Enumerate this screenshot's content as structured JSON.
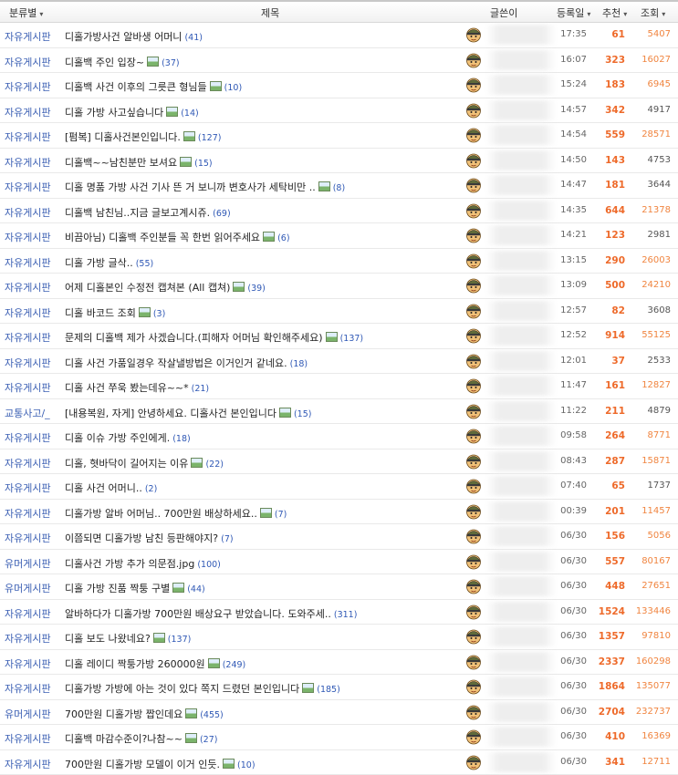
{
  "header": {
    "category": "분류별",
    "title": "제목",
    "author": "글쓴이",
    "date": "등록일",
    "recommend": "추천",
    "views": "조회",
    "sort_arrow": "▾"
  },
  "colors": {
    "category": "#3b5fb3",
    "count": "#2f58b5",
    "recommend": "#ee6a2a",
    "views_hot": "#f08540",
    "views_normal": "#555555"
  },
  "rows": [
    {
      "category": "자유게시판",
      "title": "디홀가방사건 알바생 어머니",
      "attach": false,
      "count": "(41)",
      "time": "17:35",
      "recommend": "61",
      "views": "5407",
      "hot": true
    },
    {
      "category": "자유게시판",
      "title": "디홀백 주인 입장~",
      "attach": true,
      "count": "(37)",
      "time": "16:07",
      "recommend": "323",
      "views": "16027",
      "hot": true
    },
    {
      "category": "자유게시판",
      "title": "디홀백 사건 이후의 그릇큰 형님들",
      "attach": true,
      "count": "(10)",
      "time": "15:24",
      "recommend": "183",
      "views": "6945",
      "hot": true
    },
    {
      "category": "자유게시판",
      "title": "디홀 가방 사고싶습니다",
      "attach": true,
      "count": "(14)",
      "time": "14:57",
      "recommend": "342",
      "views": "4917",
      "hot": false
    },
    {
      "category": "자유게시판",
      "title": "[펌복] 디홀사건본인입니다.",
      "attach": true,
      "count": "(127)",
      "time": "14:54",
      "recommend": "559",
      "views": "28571",
      "hot": true
    },
    {
      "category": "자유게시판",
      "title": "디홀백~~남친분만 보셔요",
      "attach": true,
      "count": "(15)",
      "time": "14:50",
      "recommend": "143",
      "views": "4753",
      "hot": false
    },
    {
      "category": "자유게시판",
      "title": "디홀 명품 가방 사건 기사 뜬 거 보니까 변호사가 세탁비만 ..",
      "attach": true,
      "count": "(8)",
      "time": "14:47",
      "recommend": "181",
      "views": "3644",
      "hot": false
    },
    {
      "category": "자유게시판",
      "title": "디홀백 남친님..지금 글보고계시쥬.",
      "attach": false,
      "count": "(69)",
      "time": "14:35",
      "recommend": "644",
      "views": "21378",
      "hot": true
    },
    {
      "category": "자유게시판",
      "title": "비끔아님) 디홀백 주인분들 꼭 한번 읽어주세요",
      "attach": true,
      "count": "(6)",
      "time": "14:21",
      "recommend": "123",
      "views": "2981",
      "hot": false
    },
    {
      "category": "자유게시판",
      "title": "디홀 가방 글삭..",
      "attach": false,
      "count": "(55)",
      "time": "13:15",
      "recommend": "290",
      "views": "26003",
      "hot": true
    },
    {
      "category": "자유게시판",
      "title": "어제 디홀본인 수정전 캡쳐본 (All 캡쳐)",
      "attach": true,
      "count": "(39)",
      "time": "13:09",
      "recommend": "500",
      "views": "24210",
      "hot": true
    },
    {
      "category": "자유게시판",
      "title": "디홀 바코드 조회",
      "attach": true,
      "count": "(3)",
      "time": "12:57",
      "recommend": "82",
      "views": "3608",
      "hot": false
    },
    {
      "category": "자유게시판",
      "title": "문제의 디홀백 제가 사겠습니다.(피해자 어머님 확인해주세요)",
      "attach": true,
      "count": "(137)",
      "time": "12:52",
      "recommend": "914",
      "views": "55125",
      "hot": true
    },
    {
      "category": "자유게시판",
      "title": "디홀 사건 가품일경우 작살낼방법은 이거인거 같네요.",
      "attach": false,
      "count": "(18)",
      "time": "12:01",
      "recommend": "37",
      "views": "2533",
      "hot": false
    },
    {
      "category": "자유게시판",
      "title": "디홀 사건 쭈욱 봤는데유~~*",
      "attach": false,
      "count": "(21)",
      "time": "11:47",
      "recommend": "161",
      "views": "12827",
      "hot": true
    },
    {
      "category": "교통사고/_",
      "title": "[내용복원, 자게] 안녕하세요. 디홀사건 본인입니다",
      "attach": true,
      "count": "(15)",
      "time": "11:22",
      "recommend": "211",
      "views": "4879",
      "hot": false
    },
    {
      "category": "자유게시판",
      "title": "디홀 이슈 가방 주인에게.",
      "attach": false,
      "count": "(18)",
      "time": "09:58",
      "recommend": "264",
      "views": "8771",
      "hot": true
    },
    {
      "category": "자유게시판",
      "title": "디홀, 혓바닥이 길어지는 이유",
      "attach": true,
      "count": "(22)",
      "time": "08:43",
      "recommend": "287",
      "views": "15871",
      "hot": true
    },
    {
      "category": "자유게시판",
      "title": "디홀 사건 어머니..",
      "attach": false,
      "count": "(2)",
      "time": "07:40",
      "recommend": "65",
      "views": "1737",
      "hot": false
    },
    {
      "category": "자유게시판",
      "title": "디홀가방 알바 어머님.. 700만원 배상하세요..",
      "attach": true,
      "count": "(7)",
      "time": "00:39",
      "recommend": "201",
      "views": "11457",
      "hot": true
    },
    {
      "category": "자유게시판",
      "title": "이쯤되면 디홀가방 남친 등판해야지?",
      "attach": false,
      "count": "(7)",
      "time": "06/30",
      "recommend": "156",
      "views": "5056",
      "hot": true
    },
    {
      "category": "유머게시판",
      "title": "디홀사건 가방 추가 의문점.jpg",
      "attach": false,
      "count": "(100)",
      "time": "06/30",
      "recommend": "557",
      "views": "80167",
      "hot": true
    },
    {
      "category": "유머게시판",
      "title": "디홀 가방 진품 짝퉁 구별",
      "attach": true,
      "count": "(44)",
      "time": "06/30",
      "recommend": "448",
      "views": "27651",
      "hot": true
    },
    {
      "category": "자유게시판",
      "title": "알바하다가 디홀가방 700만원 배상요구 받았습니다. 도와주세..",
      "attach": false,
      "count": "(311)",
      "time": "06/30",
      "recommend": "1524",
      "views": "133446",
      "hot": true
    },
    {
      "category": "자유게시판",
      "title": "디홀 보도 나왔네요?",
      "attach": true,
      "count": "(137)",
      "time": "06/30",
      "recommend": "1357",
      "views": "97810",
      "hot": true
    },
    {
      "category": "자유게시판",
      "title": "디홀 레이디 짝퉁가방 260000원",
      "attach": true,
      "count": "(249)",
      "time": "06/30",
      "recommend": "2337",
      "views": "160298",
      "hot": true
    },
    {
      "category": "자유게시판",
      "title": "디홀가방 가방에 아는 것이 있다 쪽지 드렸던 본인입니다",
      "attach": true,
      "count": "(185)",
      "time": "06/30",
      "recommend": "1864",
      "views": "135077",
      "hot": true
    },
    {
      "category": "유머게시판",
      "title": "700만원 디홀가방 짭인데요",
      "attach": true,
      "count": "(455)",
      "time": "06/30",
      "recommend": "2704",
      "views": "232737",
      "hot": true
    },
    {
      "category": "자유게시판",
      "title": "디홀백 마감수준이?나참~~",
      "attach": true,
      "count": "(27)",
      "time": "06/30",
      "recommend": "410",
      "views": "16369",
      "hot": true
    },
    {
      "category": "자유게시판",
      "title": "700만원 디홀가방 모델이 이거 인듯.",
      "attach": true,
      "count": "(10)",
      "time": "06/30",
      "recommend": "341",
      "views": "12711",
      "hot": true
    }
  ]
}
